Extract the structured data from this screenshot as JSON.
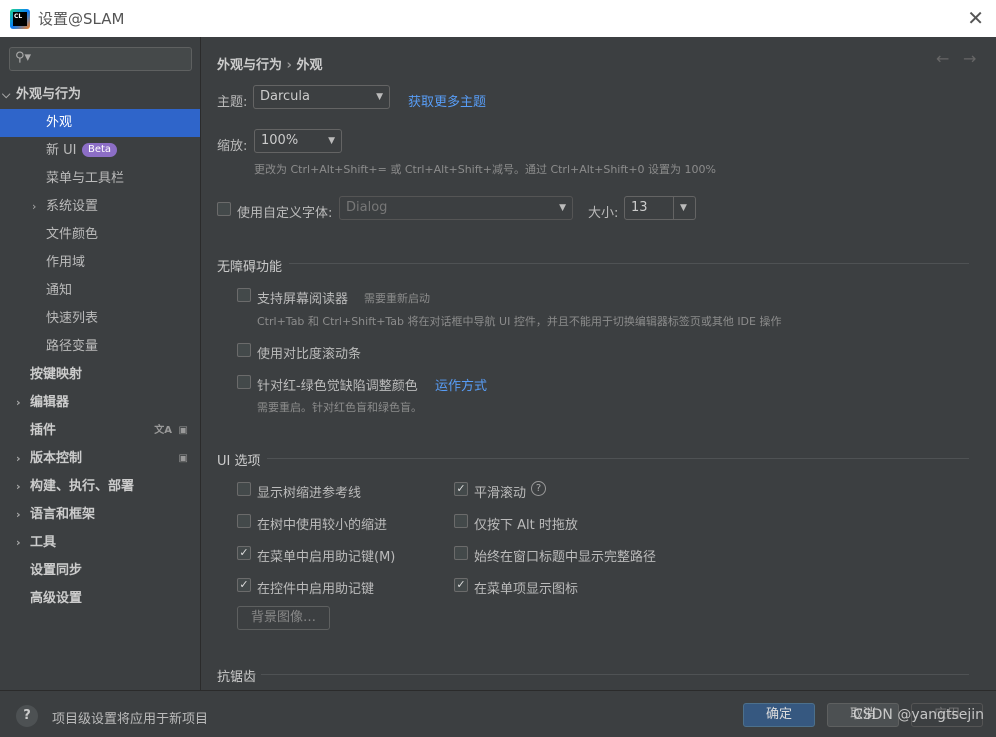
{
  "window": {
    "title": "设置@SLAM",
    "logo_text": "CL"
  },
  "sidebar": {
    "search_placeholder": "",
    "items": [
      {
        "label": "外观与行为",
        "expanded": true
      },
      {
        "label": "外观",
        "selected": true
      },
      {
        "label": "新 UI",
        "badge": "Beta"
      },
      {
        "label": "菜单与工具栏"
      },
      {
        "label": "系统设置",
        "collapsed": true
      },
      {
        "label": "文件颜色"
      },
      {
        "label": "作用域"
      },
      {
        "label": "通知"
      },
      {
        "label": "快速列表"
      },
      {
        "label": "路径变量"
      },
      {
        "label": "按键映射"
      },
      {
        "label": "编辑器"
      },
      {
        "label": "插件"
      },
      {
        "label": "版本控制"
      },
      {
        "label": "构建、执行、部署"
      },
      {
        "label": "语言和框架"
      },
      {
        "label": "工具"
      },
      {
        "label": "设置同步"
      },
      {
        "label": "高级设置"
      }
    ]
  },
  "main": {
    "breadcrumb": [
      "外观与行为",
      "外观"
    ],
    "theme_label": "主题:",
    "theme_value": "Darcula",
    "more_themes": "获取更多主题",
    "zoom_label": "缩放:",
    "zoom_value": "100%",
    "zoom_hint": "更改为 Ctrl+Alt+Shift+= 或 Ctrl+Alt+Shift+减号。通过 Ctrl+Alt+Shift+0 设置为 100%",
    "custom_font_label": "使用自定义字体:",
    "custom_font_value": "Dialog",
    "size_label": "大小:",
    "size_value": "13",
    "accessibility": {
      "title": "无障碍功能",
      "screen_reader": "支持屏幕阅读器",
      "screen_reader_note": "需要重新启动",
      "screen_reader_hint": "Ctrl+Tab 和 Ctrl+Shift+Tab 将在对话框中导航 UI 控件，并且不能用于切换编辑器标签页或其他 IDE 操作",
      "contrast_scrollbars": "使用对比度滚动条",
      "color_blind": "针对红-绿色觉缺陷调整颜色",
      "how_it_works": "运作方式",
      "color_blind_hint": "需要重启。针对红色盲和绿色盲。"
    },
    "ui_options": {
      "title": "UI 选项",
      "left": [
        {
          "label": "显示树缩进参考线",
          "checked": false
        },
        {
          "label": "在树中使用较小的缩进",
          "checked": false
        },
        {
          "label": "在菜单中启用助记键(M)",
          "checked": true
        },
        {
          "label": "在控件中启用助记键",
          "checked": true
        }
      ],
      "right": [
        {
          "label": "平滑滚动",
          "checked": true
        },
        {
          "label": "仅按下 Alt 时拖放",
          "checked": false
        },
        {
          "label": "始终在窗口标题中显示完整路径",
          "checked": false
        },
        {
          "label": "在菜单项显示图标",
          "checked": true
        }
      ],
      "background_image": "背景图像…"
    },
    "antialiasing_title": "抗锯齿"
  },
  "footer": {
    "note": "项目级设置将应用于新项目",
    "ok": "确定",
    "cancel": "取消",
    "apply": "应用",
    "watermark": "CSDN @yangtsejin"
  }
}
